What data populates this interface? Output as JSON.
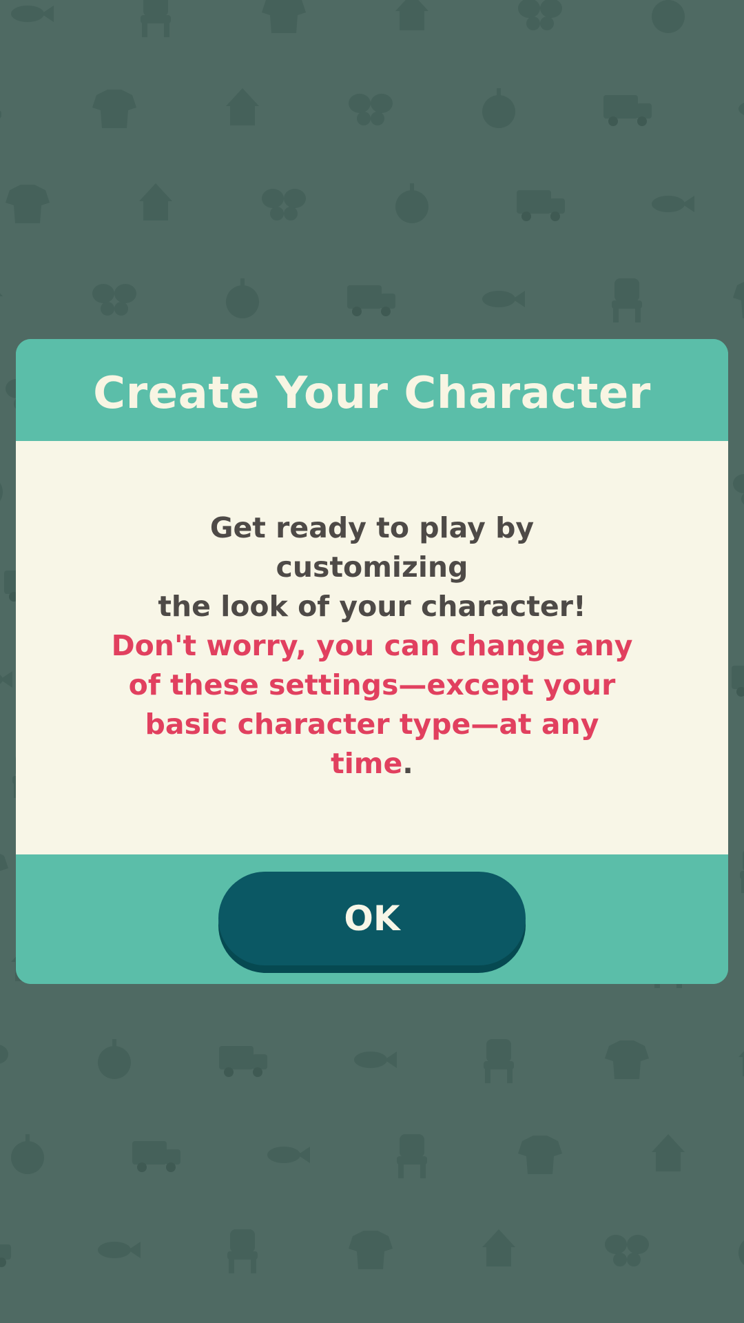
{
  "background": {
    "color": "#4f6a63",
    "pattern_icons": [
      "fish-icon",
      "chair-icon",
      "shirt-icon",
      "house-icon",
      "butterfly-icon",
      "fruit-icon",
      "truck-icon"
    ]
  },
  "dialog": {
    "title": "Create Your Character",
    "message": {
      "line1": "Get ready to play by customizing",
      "line2": "the look of your character!",
      "note_line1": "Don't worry, you can change any",
      "note_line2": "of these settings—except your",
      "note_line3": "basic character type—at any time",
      "note_end": "."
    },
    "ok_label": "OK"
  },
  "colors": {
    "header": "#5bbea9",
    "body": "#f8f6e7",
    "title_text": "#f8f5e3",
    "message_text": "#4e4a47",
    "note_text": "#e1405f",
    "button": "#0b5864"
  }
}
